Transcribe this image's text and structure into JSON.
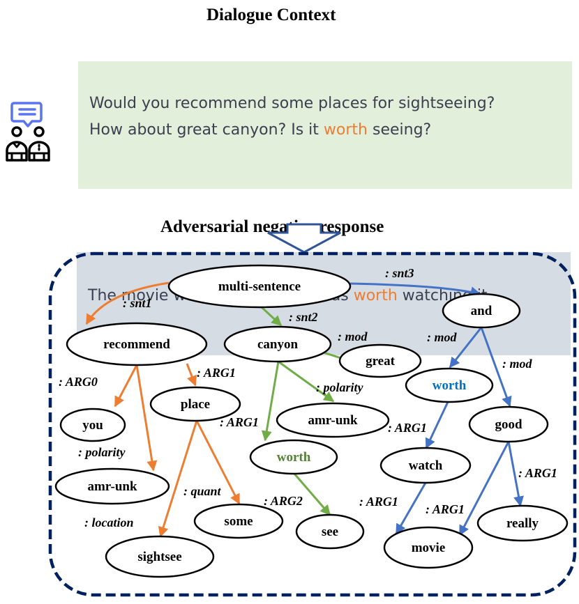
{
  "dialogue_context": {
    "title": "Dialogue Context",
    "line1": "Would you recommend some places for sightseeing?",
    "line2_before": "How about great canyon? Is it ",
    "line2_highlight": "worth",
    "line2_after": " seeing?"
  },
  "adversarial_response": {
    "title": "Adversarial negative response",
    "text_before": "The movie was really good, it was ",
    "text_highlight": "worth",
    "text_after": " watching it."
  },
  "icons": {
    "speakers": "two-people-chat-icon",
    "arrow": "down-arrow-icon"
  },
  "colors": {
    "context_bg": "#e2efda",
    "response_bg": "#d6dce4",
    "highlight": "#ed7d31",
    "snt1_edges": "#ed7d31",
    "snt2_edges": "#70ad47",
    "snt3_edges": "#4472c4",
    "frame": "#002060"
  },
  "graph": {
    "nodes": [
      {
        "id": "multi",
        "label": "multi-sentence",
        "color": "#000000"
      },
      {
        "id": "recommend",
        "label": "recommend",
        "color": "#000000"
      },
      {
        "id": "you",
        "label": "you",
        "color": "#000000"
      },
      {
        "id": "amrunk1",
        "label": "amr-unk",
        "color": "#000000"
      },
      {
        "id": "place",
        "label": "place",
        "color": "#000000"
      },
      {
        "id": "sightsee",
        "label": "sightsee",
        "color": "#000000"
      },
      {
        "id": "some",
        "label": "some",
        "color": "#000000"
      },
      {
        "id": "canyon",
        "label": "canyon",
        "color": "#000000"
      },
      {
        "id": "great",
        "label": "great",
        "color": "#000000"
      },
      {
        "id": "amrunk2",
        "label": "amr-unk",
        "color": "#000000"
      },
      {
        "id": "worth1",
        "label": "worth",
        "color": "#548235"
      },
      {
        "id": "see",
        "label": "see",
        "color": "#000000"
      },
      {
        "id": "and",
        "label": "and",
        "color": "#000000"
      },
      {
        "id": "worth2",
        "label": "worth",
        "color": "#0070c0"
      },
      {
        "id": "good",
        "label": "good",
        "color": "#000000"
      },
      {
        "id": "watch",
        "label": "watch",
        "color": "#000000"
      },
      {
        "id": "movie",
        "label": "movie",
        "color": "#000000"
      },
      {
        "id": "really",
        "label": "really",
        "color": "#000000"
      }
    ],
    "edges": [
      {
        "from": "multi",
        "to": "recommend",
        "label": ":snt1",
        "group": "snt1"
      },
      {
        "from": "recommend",
        "to": "you",
        "label": ":ARG0",
        "group": "snt1"
      },
      {
        "from": "recommend",
        "to": "amrunk1",
        "label": ":polarity",
        "group": "snt1"
      },
      {
        "from": "recommend",
        "to": "place",
        "label": ":ARG1",
        "group": "snt1"
      },
      {
        "from": "place",
        "to": "sightsee",
        "label": ":location",
        "group": "snt1"
      },
      {
        "from": "place",
        "to": "some",
        "label": ":quant",
        "group": "snt1"
      },
      {
        "from": "multi",
        "to": "canyon",
        "label": ":snt2",
        "group": "snt2"
      },
      {
        "from": "canyon",
        "to": "great",
        "label": ":mod",
        "group": "snt2"
      },
      {
        "from": "canyon",
        "to": "amrunk2",
        "label": ":polarity",
        "group": "snt2"
      },
      {
        "from": "canyon",
        "to": "worth1",
        "label": ":ARG1",
        "group": "snt2"
      },
      {
        "from": "worth1",
        "to": "see",
        "label": ":ARG2",
        "group": "snt2"
      },
      {
        "from": "multi",
        "to": "and",
        "label": ":snt3",
        "group": "snt3"
      },
      {
        "from": "and",
        "to": "worth2",
        "label": ":mod",
        "group": "snt3"
      },
      {
        "from": "and",
        "to": "good",
        "label": ":mod",
        "group": "snt3"
      },
      {
        "from": "worth2",
        "to": "watch",
        "label": ":ARG1",
        "group": "snt3"
      },
      {
        "from": "watch",
        "to": "movie",
        "label": ":ARG1",
        "group": "snt3"
      },
      {
        "from": "good",
        "to": "movie",
        "label": ":ARG1",
        "group": "snt3"
      },
      {
        "from": "good",
        "to": "really",
        "label": ":ARG1",
        "group": "snt3"
      }
    ]
  }
}
